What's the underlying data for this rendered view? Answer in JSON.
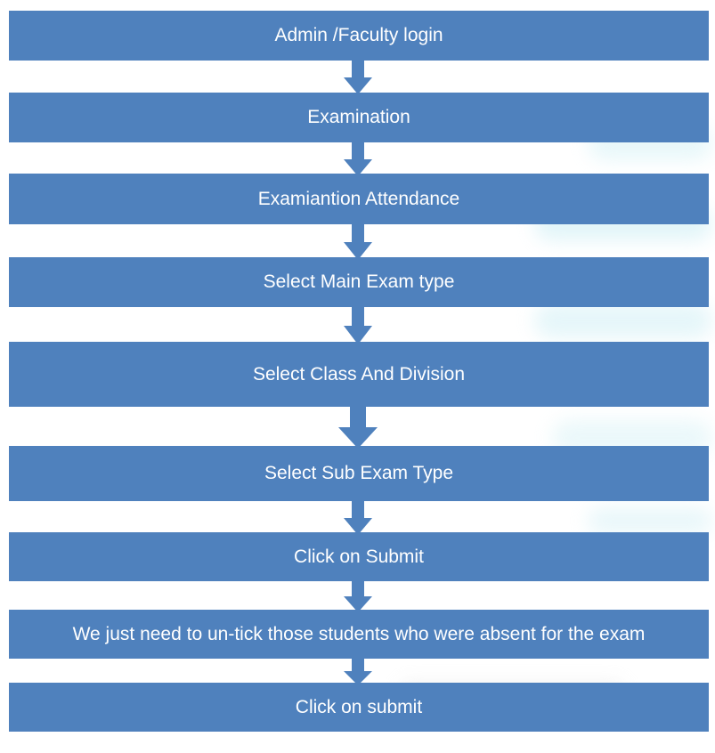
{
  "flowchart": {
    "steps": [
      {
        "label": "Admin /Faculty login"
      },
      {
        "label": "Examination"
      },
      {
        "label": "Examiantion Attendance"
      },
      {
        "label": "Select Main Exam type"
      },
      {
        "label": "Select Class And Division"
      },
      {
        "label": "Select Sub Exam Type"
      },
      {
        "label": "Click on Submit"
      },
      {
        "label": "We just need to un-tick those students who were absent for the exam"
      },
      {
        "label": "Click on submit"
      }
    ],
    "colors": {
      "box_fill": "#4f81bd",
      "text": "#ffffff",
      "arrow_fill": "#4f81bd"
    }
  }
}
